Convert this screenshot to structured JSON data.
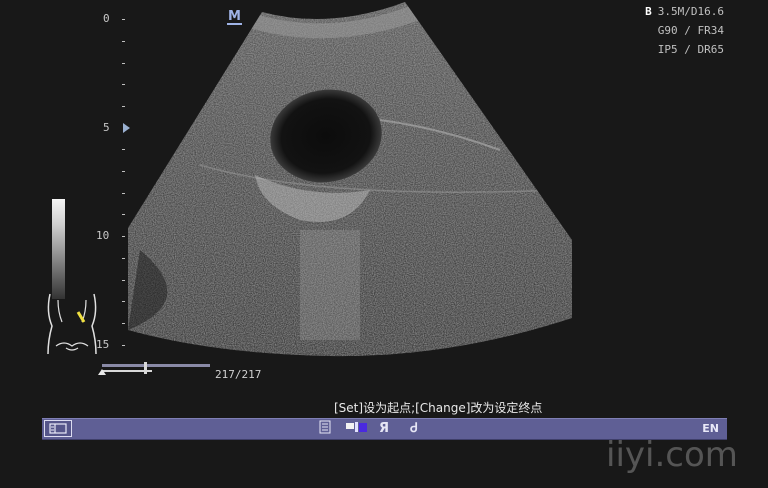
{
  "mode_logo": "M",
  "parameters": {
    "mode": "B",
    "line1": "3.5M/D16.6",
    "line2": "G90 / FR34",
    "line3": "IP5 / DR65"
  },
  "depth_scale": {
    "labels": [
      "0",
      "5",
      "10",
      "15"
    ],
    "unit_marks": 15
  },
  "cine": {
    "frame_counter": "217/217"
  },
  "hint": "[Set]设为起点;[Change]改为设定终点",
  "statusbar": {
    "language": "EN",
    "icons": [
      "document-icon",
      "color-bar-icon",
      "mirror-r-icon",
      "rotate-icon"
    ],
    "mirror_glyph": "Я",
    "rotate_glyph": "Ꮷ"
  },
  "watermark": "iiyi.com"
}
